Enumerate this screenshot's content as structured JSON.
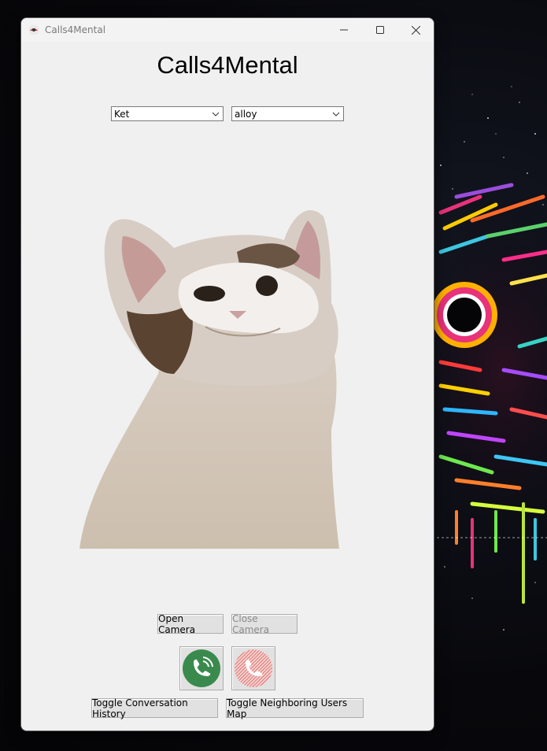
{
  "window": {
    "title": "Calls4Mental"
  },
  "main": {
    "heading": "Calls4Mental"
  },
  "selectors": {
    "model": {
      "selected": "Ket"
    },
    "voice": {
      "selected": "alloy"
    }
  },
  "camera": {
    "open_label": "Open Camera",
    "close_label": "Close Camera"
  },
  "call": {
    "start_icon": "phone-call-icon",
    "end_icon": "phone-hangup-icon",
    "start_color": "#3a8a4e",
    "end_color": "#d9534f"
  },
  "toggles": {
    "history_label": "Toggle Conversation History",
    "map_label": "Toggle Neighboring Users Map"
  }
}
